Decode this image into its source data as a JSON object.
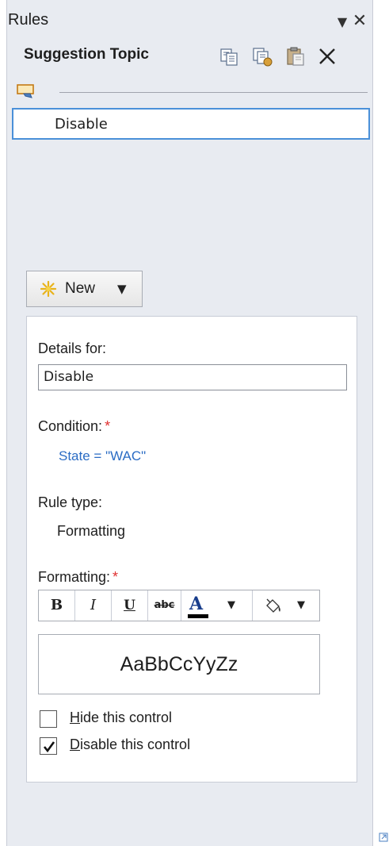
{
  "pane": {
    "title": "Rules",
    "dropdown_icon": "chevron-down-icon",
    "close_icon": "close-icon"
  },
  "header": {
    "group_title": "Suggestion Topic",
    "tools": [
      {
        "name": "copy-rule-icon"
      },
      {
        "name": "copy-all-rules-icon"
      },
      {
        "name": "paste-rule-icon"
      },
      {
        "name": "delete-rule-icon"
      }
    ]
  },
  "rules": {
    "section_icon": "rule-group-icon",
    "items": [
      {
        "label": "Disable",
        "selected": true
      }
    ]
  },
  "new_button": {
    "label": "New",
    "icon": "new-star-icon"
  },
  "details": {
    "details_for_label": "Details for:",
    "name_value": "Disable",
    "condition_label": "Condition:",
    "required_mark": "*",
    "condition_value": "State = \"WAC\"",
    "rule_type_label": "Rule type:",
    "rule_type_value": "Formatting",
    "formatting_label": "Formatting:",
    "preview_text": "AaBbCcYyZz",
    "format_buttons": {
      "bold": "B",
      "italic": "I",
      "underline": "U",
      "strike": "abc",
      "font_color": "A"
    },
    "checkboxes": [
      {
        "accel": "H",
        "rest": "ide this control",
        "checked": false
      },
      {
        "accel": "D",
        "rest": "isable this control",
        "checked": true
      }
    ]
  },
  "colors": {
    "accent_selection": "#4a90d9",
    "link": "#2b6cc4",
    "required": "#e03030",
    "pane_bg": "#e8ebf1"
  }
}
